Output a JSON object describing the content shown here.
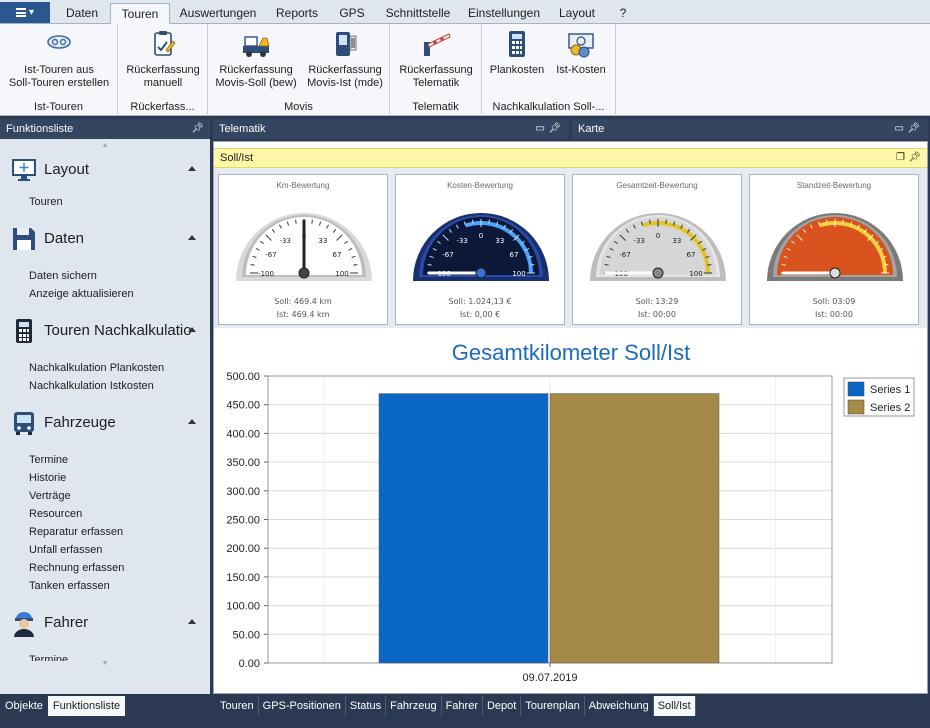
{
  "ribbon": {
    "tabs": [
      "Daten",
      "Touren",
      "Auswertungen",
      "Reports",
      "GPS",
      "Schnittstelle",
      "Einstellungen",
      "Layout",
      "?"
    ],
    "active_tab": "Touren",
    "groups": [
      {
        "label": "Ist-Touren",
        "buttons": [
          {
            "line1": "Ist-Touren aus",
            "line2": "Soll-Touren erstellen",
            "icon": "route-icon"
          }
        ]
      },
      {
        "label": "Rückerfass...",
        "buttons": [
          {
            "line1": "Rückerfassung",
            "line2": "manuell",
            "icon": "clipboard-edit-icon"
          }
        ]
      },
      {
        "label": "Movis",
        "buttons": [
          {
            "line1": "Rückerfassung",
            "line2": "Movis-Soll (bew)",
            "icon": "truck-icon"
          },
          {
            "line1": "Rückerfassung",
            "line2": "Movis-Ist (mde)",
            "icon": "scanner-icon"
          }
        ]
      },
      {
        "label": "Telematik",
        "buttons": [
          {
            "line1": "Rückerfassung",
            "line2": "Telematik",
            "icon": "barrier-icon"
          }
        ]
      },
      {
        "label": "Nachkalkulation Soll-...",
        "buttons": [
          {
            "line1": "Plankosten",
            "line2": "",
            "icon": "calculator-icon"
          },
          {
            "line1": "Ist-Kosten",
            "line2": "",
            "icon": "money-icon"
          }
        ]
      }
    ]
  },
  "left_panel": {
    "title": "Funktionsliste",
    "sections": [
      {
        "title": "Layout",
        "icon": "monitor-icon",
        "items": [
          "Touren"
        ]
      },
      {
        "title": "Daten",
        "icon": "floppy-icon",
        "items": [
          "Daten sichern",
          "Anzeige aktualisieren"
        ]
      },
      {
        "title": "Touren Nachkalkulatio",
        "icon": "calculator-icon",
        "items": [
          "Nachkalkulation Plankosten",
          "Nachkalkulation Istkosten"
        ]
      },
      {
        "title": "Fahrzeuge",
        "icon": "bus-icon",
        "items": [
          "Termine",
          "Historie",
          "Verträge",
          "Resourcen",
          "Reparatur erfassen",
          "Unfall erfassen",
          "Rechnung erfassen",
          "Tanken erfassen"
        ]
      },
      {
        "title": "Fahrer",
        "icon": "driver-icon",
        "items": [
          "Termine"
        ]
      }
    ],
    "bottom_tabs": [
      "Objekte",
      "Funktionsliste"
    ],
    "active_bottom_tab": "Funktionsliste"
  },
  "docks": {
    "telematik": "Telematik",
    "karte": "Karte",
    "sollist": "Soll/Ist"
  },
  "gauges": [
    {
      "title": "Km-Bewertung",
      "soll": "Soll: 469.4 km",
      "ist": "Ist: 469.4 km",
      "ticks": [
        "-100",
        "-67",
        "-33",
        "0",
        "33",
        "67",
        "100"
      ],
      "value": 0,
      "style": "silver"
    },
    {
      "title": "Kosten-Bewertung",
      "soll": "Soll: 1.024,13 €",
      "ist": "Ist: 0,00 €",
      "ticks": [
        "-100",
        "-67",
        "-33",
        "0",
        "33",
        "67",
        "100"
      ],
      "value": -100,
      "style": "blue"
    },
    {
      "title": "Gesamtzeit-Bewertung",
      "soll": "Soll: 13:29",
      "ist": "Ist: 00:00",
      "ticks": [
        "-100",
        "-67",
        "-33",
        "0",
        "33",
        "67",
        "100"
      ],
      "value": -100,
      "style": "chrome"
    },
    {
      "title": "Standzeit-Bewertung",
      "soll": "Soll: 03:09",
      "ist": "Ist: 00:00",
      "ticks": [],
      "value": -100,
      "style": "red"
    }
  ],
  "chart_data": {
    "type": "bar",
    "title": "Gesamtkilometer Soll/Ist",
    "categories": [
      "09.07.2019"
    ],
    "series": [
      {
        "name": "Series 1",
        "values": [
          469.4
        ],
        "color": "#0a67c4"
      },
      {
        "name": "Series 2",
        "values": [
          469.4
        ],
        "color": "#a58a47"
      }
    ],
    "ylim": [
      0,
      500
    ],
    "yticks": [
      "0.00",
      "50.00",
      "100.00",
      "150.00",
      "200.00",
      "250.00",
      "300.00",
      "350.00",
      "400.00",
      "450.00",
      "500.00"
    ],
    "legend": "top-right",
    "grid": true
  },
  "bottom_tabs": [
    "Touren",
    "GPS-Positionen",
    "Status",
    "Fahrzeug",
    "Fahrer",
    "Depot",
    "Tourenplan",
    "Abweichung",
    "Soll/Ist"
  ],
  "active_bottom_tab": "Soll/Ist"
}
